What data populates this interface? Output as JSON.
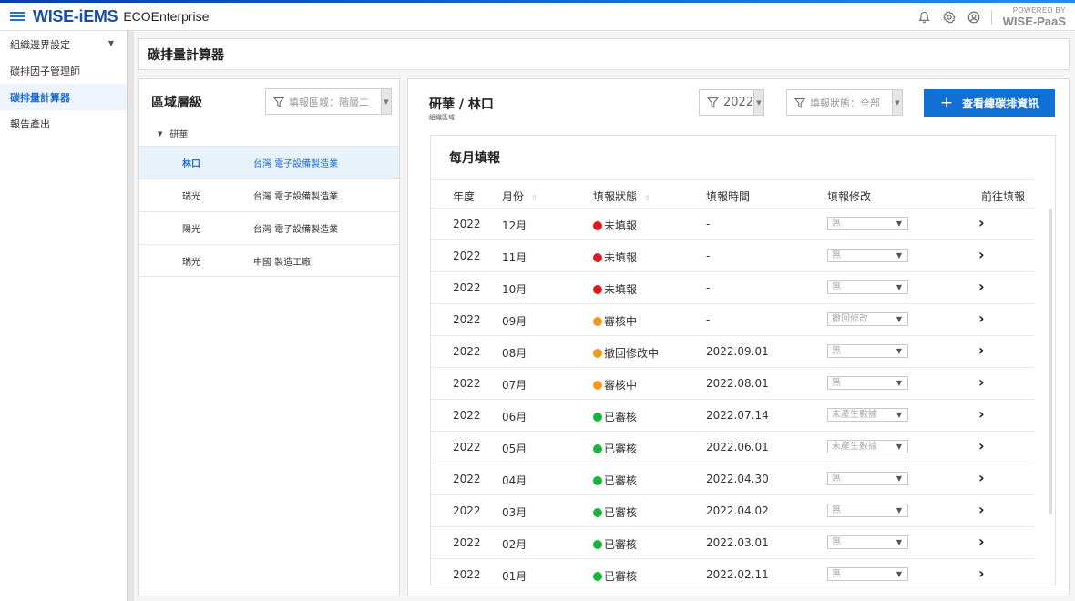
{
  "header": {
    "brand": "WISE-iEMS",
    "product": "ECOEnterprise",
    "powered_small": "POWERED BY",
    "powered_big": "WISE-PaaS",
    "icons": [
      "bell-icon",
      "gear-icon",
      "user-icon"
    ]
  },
  "sidebar": {
    "items": [
      {
        "label": "組織邊界設定",
        "has_caret": true
      },
      {
        "label": "碳排因子管理師"
      },
      {
        "label": "碳排量計算器",
        "active": true
      },
      {
        "label": "報告產出"
      }
    ]
  },
  "page": {
    "title": "碳排量計算器"
  },
  "region_panel": {
    "title": "區域層級",
    "filter_placeholder": "填報區域：階層二",
    "tree_root": "研華",
    "rows": [
      {
        "name": "林口",
        "desc": "台灣 電子設備製造業",
        "selected": true
      },
      {
        "name": "瑞光",
        "desc": "台灣 電子設備製造業"
      },
      {
        "name": "陽光",
        "desc": "台灣 電子設備製造業"
      },
      {
        "name": "瑞光",
        "desc": "中國 製造工廠"
      }
    ]
  },
  "detail": {
    "title": "研華 / 林口",
    "subtitle": "組織區域",
    "year_filter": "2022",
    "status_filter": "填報狀態：全部",
    "primary_button": "查看總碳排資訊",
    "monthly": {
      "title": "每月填報",
      "columns": {
        "year": "年度",
        "month": "月份",
        "status": "填報狀態",
        "time": "填報時間",
        "modify": "填報修改",
        "goto": "前往填報"
      },
      "colors": {
        "red": "#e0181f",
        "orange": "#f39a1e",
        "green": "#18b53a"
      },
      "rows": [
        {
          "year": "2022",
          "month": "12月",
          "status": "未填報",
          "status_color": "red",
          "time": "-",
          "modify": "無"
        },
        {
          "year": "2022",
          "month": "11月",
          "status": "未填報",
          "status_color": "red",
          "time": "-",
          "modify": "無"
        },
        {
          "year": "2022",
          "month": "10月",
          "status": "未填報",
          "status_color": "red",
          "time": "-",
          "modify": "無"
        },
        {
          "year": "2022",
          "month": "09月",
          "status": "審核中",
          "status_color": "orange",
          "time": "-",
          "modify": "撤回修改"
        },
        {
          "year": "2022",
          "month": "08月",
          "status": "撤回修改中",
          "status_color": "orange",
          "time": "2022.09.01",
          "modify": "無"
        },
        {
          "year": "2022",
          "month": "07月",
          "status": "審核中",
          "status_color": "orange",
          "time": "2022.08.01",
          "modify": "無"
        },
        {
          "year": "2022",
          "month": "06月",
          "status": "已審核",
          "status_color": "green",
          "time": "2022.07.14",
          "modify": "未產生數據"
        },
        {
          "year": "2022",
          "month": "05月",
          "status": "已審核",
          "status_color": "green",
          "time": "2022.06.01",
          "modify": "未產生數據"
        },
        {
          "year": "2022",
          "month": "04月",
          "status": "已審核",
          "status_color": "green",
          "time": "2022.04.30",
          "modify": "無"
        },
        {
          "year": "2022",
          "month": "03月",
          "status": "已審核",
          "status_color": "green",
          "time": "2022.04.02",
          "modify": "無"
        },
        {
          "year": "2022",
          "month": "02月",
          "status": "已審核",
          "status_color": "green",
          "time": "2022.03.01",
          "modify": "無"
        },
        {
          "year": "2022",
          "month": "01月",
          "status": "已審核",
          "status_color": "green",
          "time": "2022.02.11",
          "modify": "無"
        }
      ]
    }
  }
}
